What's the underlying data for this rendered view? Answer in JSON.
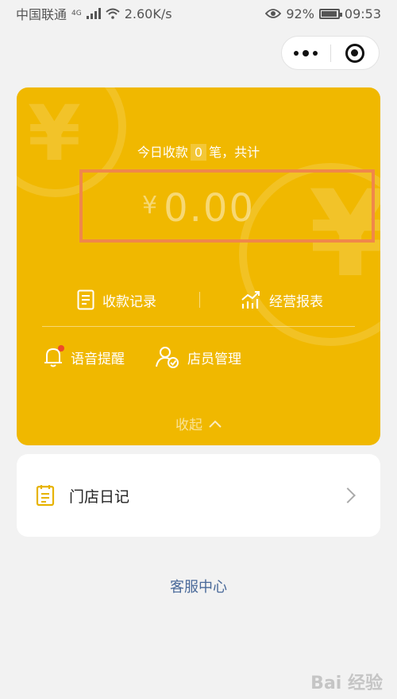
{
  "status_bar": {
    "carrier": "中国联通",
    "network": "4G",
    "speed": "2.60K/s",
    "battery": "92%",
    "time": "09:53"
  },
  "capsule": {
    "more_icon": "more-dots-icon",
    "close_icon": "target-close-icon"
  },
  "summary": {
    "prefix": "今日收款",
    "count": "0",
    "suffix": "笔，共计",
    "currency": "¥",
    "amount": "0.00"
  },
  "actions": {
    "records": "收款记录",
    "reports": "经营报表",
    "voice": "语音提醒",
    "staff": "店员管理",
    "collapse": "收起"
  },
  "diary": {
    "label": "门店日记"
  },
  "service": {
    "label": "客服中心"
  },
  "watermark": "Bai 经验",
  "colors": {
    "card": "#f0b800",
    "highlight_box": "#f0874a",
    "badge": "#ee4a2a",
    "link": "#4a6a9a"
  }
}
